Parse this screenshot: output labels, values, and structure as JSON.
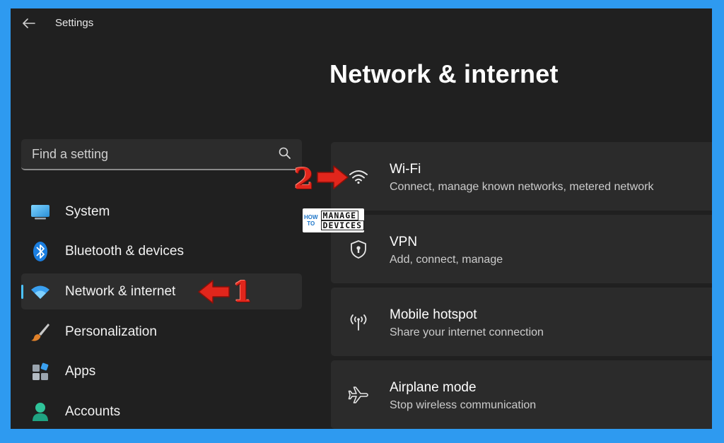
{
  "window": {
    "title": "Settings"
  },
  "page": {
    "title": "Network & internet"
  },
  "search": {
    "placeholder": "Find a setting"
  },
  "sidebar": {
    "items": [
      {
        "label": "System",
        "icon": "monitor-icon",
        "active": false
      },
      {
        "label": "Bluetooth & devices",
        "icon": "bluetooth-icon",
        "active": false
      },
      {
        "label": "Network & internet",
        "icon": "wifi-icon",
        "active": true
      },
      {
        "label": "Personalization",
        "icon": "brush-icon",
        "active": false
      },
      {
        "label": "Apps",
        "icon": "apps-icon",
        "active": false
      },
      {
        "label": "Accounts",
        "icon": "person-icon",
        "active": false
      }
    ]
  },
  "cards": [
    {
      "title": "Wi-Fi",
      "subtitle": "Connect, manage known networks, metered network",
      "icon": "wifi-icon"
    },
    {
      "title": "VPN",
      "subtitle": "Add, connect, manage",
      "icon": "shield-icon"
    },
    {
      "title": "Mobile hotspot",
      "subtitle": "Share your internet connection",
      "icon": "hotspot-icon"
    },
    {
      "title": "Airplane mode",
      "subtitle": "Stop wireless communication",
      "icon": "airplane-icon"
    }
  ],
  "annotations": {
    "step1": "1",
    "step2": "2"
  },
  "logo": {
    "left_top": "HOW",
    "left_bottom": "TO",
    "right_top": "MANAGE",
    "right_bottom": "DEVICES"
  },
  "colors": {
    "accent": "#4cc2ff",
    "window_bg": "#202020",
    "card_bg": "#2b2b2b",
    "frame": "#2e9af0",
    "annotation": "#e1261c"
  }
}
